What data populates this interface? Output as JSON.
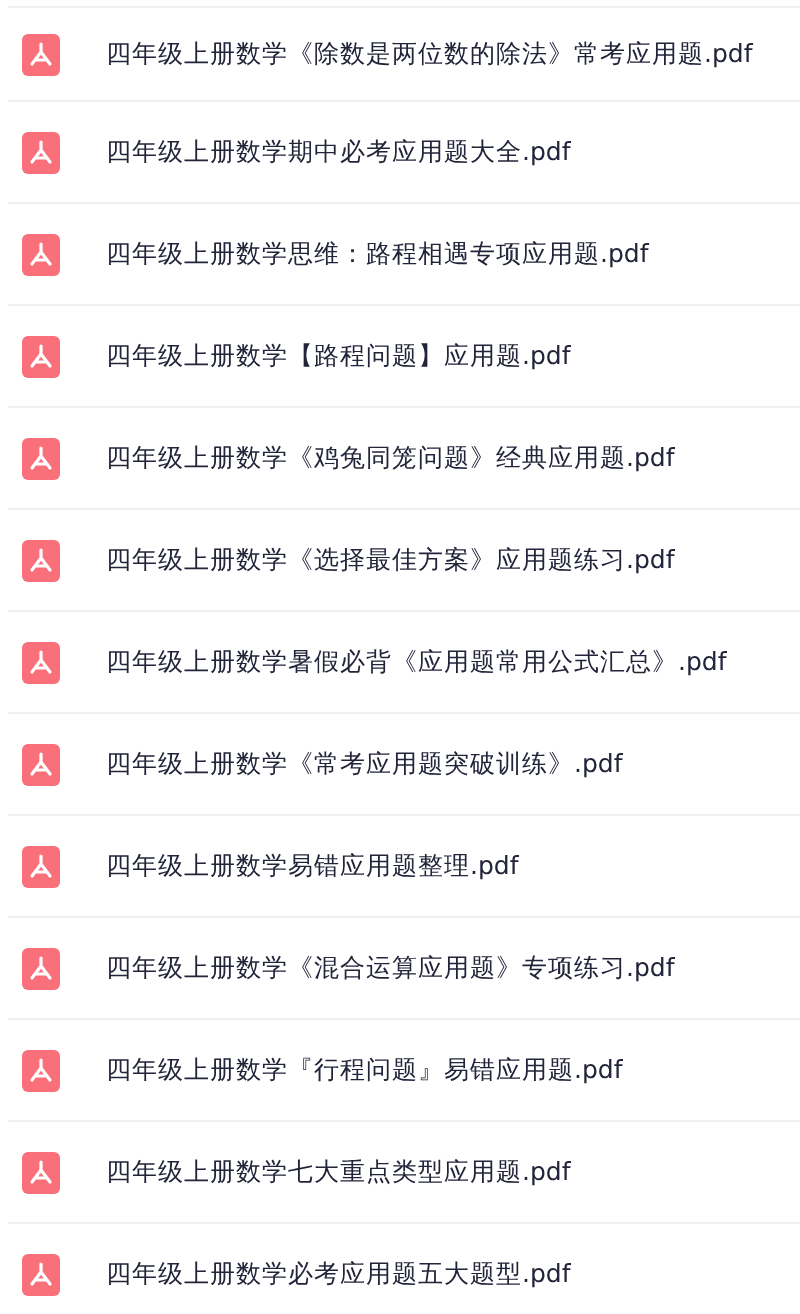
{
  "files": [
    {
      "name": "四年级上册数学《除数是两位数的除法》常考应用题.pdf"
    },
    {
      "name": "四年级上册数学期中必考应用题大全.pdf"
    },
    {
      "name": "四年级上册数学思维：路程相遇专项应用题.pdf"
    },
    {
      "name": "四年级上册数学【路程问题】应用题.pdf"
    },
    {
      "name": "四年级上册数学《鸡兔同笼问题》经典应用题.pdf"
    },
    {
      "name": "四年级上册数学《选择最佳方案》应用题练习.pdf"
    },
    {
      "name": "四年级上册数学暑假必背《应用题常用公式汇总》.pdf"
    },
    {
      "name": "四年级上册数学《常考应用题突破训练》.pdf"
    },
    {
      "name": "四年级上册数学易错应用题整理.pdf"
    },
    {
      "name": "四年级上册数学《混合运算应用题》专项练习.pdf"
    },
    {
      "name": "四年级上册数学『行程问题』易错应用题.pdf"
    },
    {
      "name": "四年级上册数学七大重点类型应用题.pdf"
    },
    {
      "name": "四年级上册数学必考应用题五大题型.pdf"
    }
  ]
}
